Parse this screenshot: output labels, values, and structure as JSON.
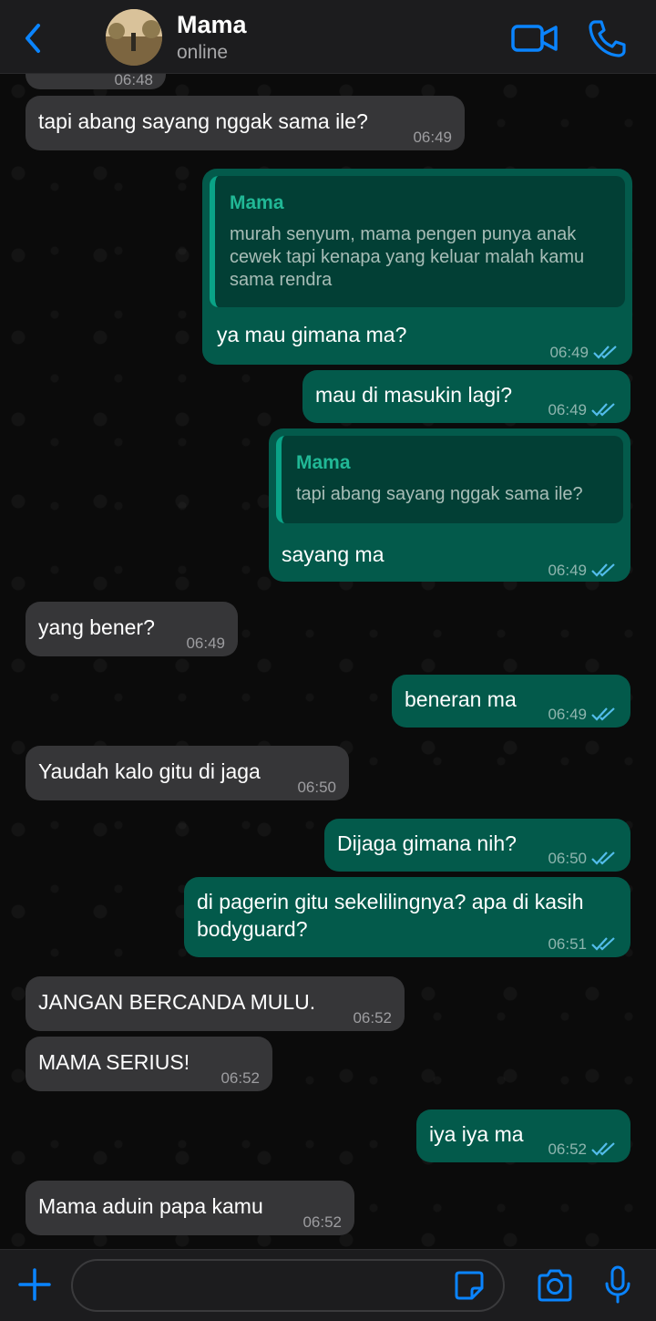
{
  "header": {
    "contact_name": "Mama",
    "status": "online",
    "back_icon": "chevron-left-icon",
    "video_icon": "video-camera-icon",
    "call_icon": "phone-icon",
    "accent": "#0a84ff"
  },
  "messages": [
    {
      "dir": "in",
      "text": "",
      "time": "06:48"
    },
    {
      "dir": "in",
      "text": "tapi abang sayang nggak sama ile?",
      "time": "06:49"
    },
    {
      "dir": "out",
      "quote_name": "Mama",
      "quote_text": "murah senyum, mama pengen punya anak cewek tapi kenapa yang keluar malah kamu sama rendra",
      "text": "ya mau gimana ma?",
      "time": "06:49"
    },
    {
      "dir": "out",
      "text": "mau di masukin lagi?",
      "time": "06:49"
    },
    {
      "dir": "out",
      "quote_name": "Mama",
      "quote_text": "tapi abang sayang nggak sama ile?",
      "text": "sayang ma",
      "time": "06:49"
    },
    {
      "dir": "in",
      "text": "yang bener?",
      "time": "06:49"
    },
    {
      "dir": "out",
      "text": "beneran ma",
      "time": "06:49"
    },
    {
      "dir": "in",
      "text": "Yaudah kalo gitu di jaga",
      "time": "06:50"
    },
    {
      "dir": "out",
      "text": "Dijaga gimana nih?",
      "time": "06:50"
    },
    {
      "dir": "out",
      "text_line1": "di pagerin gitu sekelilingnya? apa di kasih",
      "text_line2": "bodyguard?",
      "time": "06:51"
    },
    {
      "dir": "in",
      "text": "JANGAN BERCANDA MULU.",
      "time": "06:52"
    },
    {
      "dir": "in",
      "text": "MAMA SERIUS!",
      "time": "06:52"
    },
    {
      "dir": "out",
      "text": "iya iya ma",
      "time": "06:52"
    },
    {
      "dir": "in",
      "text": "Mama aduin papa kamu",
      "time": "06:52"
    }
  ],
  "footer": {
    "placeholder": "",
    "plus_icon": "plus-icon",
    "sticker_icon": "sticker-icon",
    "camera_icon": "camera-icon",
    "mic_icon": "microphone-icon"
  }
}
